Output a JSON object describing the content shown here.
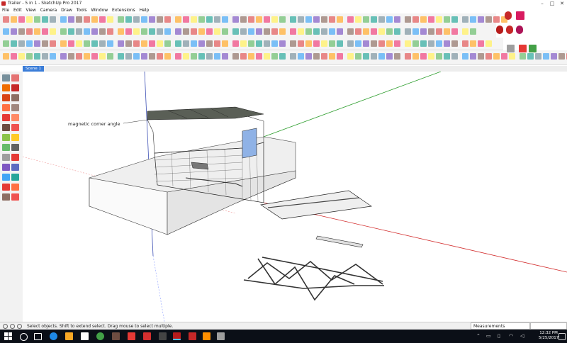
{
  "window": {
    "title": "Trailer - 5 in 1 - SketchUp Pro 2017",
    "controls": [
      "–",
      "□",
      "✕"
    ]
  },
  "menu": {
    "items": [
      "File",
      "Edit",
      "View",
      "Camera",
      "Draw",
      "Tools",
      "Window",
      "Extensions",
      "Help"
    ]
  },
  "scene_tab": {
    "label": "Scene 1"
  },
  "viewport": {
    "annotation": "magnetic corner angle",
    "axis_colors": {
      "red": "#d32f2f",
      "green": "#2e9e2e",
      "blue": "#3f51b5"
    }
  },
  "status": {
    "message": "Select objects. Shift to extend select. Drag mouse to select multiple.",
    "measurements_label": "Measurements"
  },
  "taskbar": {
    "clock_time": "12:32 PM",
    "clock_date": "5/25/2017"
  },
  "icons": {
    "title": "sketchup-app-icon",
    "left_tools": [
      "select-icon",
      "eraser-icon",
      "paint-bucket-icon",
      "line-icon",
      "arc-icon",
      "rectangle-icon",
      "circle-icon",
      "polygon-icon",
      "move-icon",
      "rotate-icon",
      "scale-icon",
      "push-pull-icon",
      "offset-icon",
      "tape-measure-icon",
      "protractor-icon",
      "text-icon",
      "dimension-icon",
      "axes-icon",
      "orbit-icon",
      "pan-icon",
      "zoom-icon",
      "zoom-extents-icon",
      "walk-icon",
      "look-around-icon",
      "position-camera-icon",
      "section-plane-icon"
    ]
  }
}
